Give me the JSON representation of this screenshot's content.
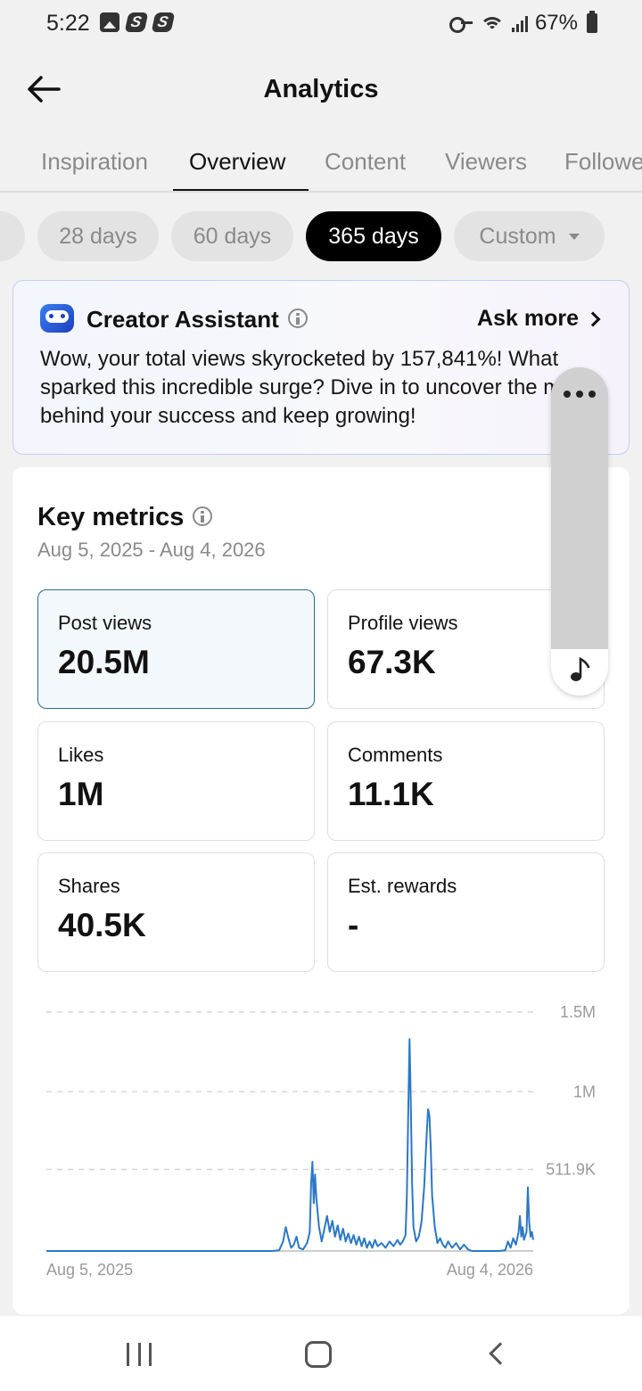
{
  "status_bar": {
    "time": "5:22",
    "battery": "67%"
  },
  "header": {
    "title": "Analytics"
  },
  "tabs": [
    {
      "label": "Inspiration",
      "active": false
    },
    {
      "label": "Overview",
      "active": true
    },
    {
      "label": "Content",
      "active": false
    },
    {
      "label": "Viewers",
      "active": false
    },
    {
      "label": "Followers",
      "active": false
    }
  ],
  "ranges": [
    {
      "label": "28 days",
      "active": false
    },
    {
      "label": "60 days",
      "active": false
    },
    {
      "label": "365 days",
      "active": true
    },
    {
      "label": "Custom",
      "active": false
    }
  ],
  "assistant": {
    "title": "Creator Assistant",
    "ask_more": "Ask more",
    "message": "Wow, your total views skyrocketed by 157,841%! What sparked this incredible surge? Dive in to uncover the magic behind your success and keep growing!"
  },
  "key_metrics": {
    "title": "Key metrics",
    "date_range": "Aug 5, 2025 - Aug 4, 2026",
    "items": [
      {
        "label": "Post views",
        "value": "20.5M",
        "selected": true
      },
      {
        "label": "Profile views",
        "value": "67.3K",
        "selected": false
      },
      {
        "label": "Likes",
        "value": "1M",
        "selected": false
      },
      {
        "label": "Comments",
        "value": "11.1K",
        "selected": false
      },
      {
        "label": "Shares",
        "value": "40.5K",
        "selected": false
      },
      {
        "label": "Est. rewards",
        "value": "-",
        "selected": false
      }
    ]
  },
  "colors": {
    "accent_line": "#2a78c8",
    "selected_border": "#2c6a8e",
    "active_chip": "#000000"
  },
  "chart_data": {
    "type": "line",
    "x_start_label": "Aug 5, 2025",
    "x_end_label": "Aug 4, 2026",
    "y_ticks": [
      {
        "value": 1500000,
        "label": "1.5M"
      },
      {
        "value": 1000000,
        "label": "1M"
      },
      {
        "value": 511900,
        "label": "511.9K"
      }
    ],
    "ylim": [
      0,
      1500000
    ],
    "grid": true,
    "series": [
      {
        "values": [
          [
            0,
            0
          ],
          [
            60,
            0
          ],
          [
            120,
            0
          ],
          [
            170,
            0
          ],
          [
            175,
            5000
          ],
          [
            178,
            60000
          ],
          [
            180,
            150000
          ],
          [
            182,
            80000
          ],
          [
            184,
            20000
          ],
          [
            186,
            40000
          ],
          [
            188,
            90000
          ],
          [
            190,
            20000
          ],
          [
            193,
            10000
          ],
          [
            196,
            50000
          ],
          [
            198,
            120000
          ],
          [
            199,
            420000
          ],
          [
            200,
            560000
          ],
          [
            201,
            300000
          ],
          [
            202,
            480000
          ],
          [
            203,
            330000
          ],
          [
            205,
            150000
          ],
          [
            207,
            60000
          ],
          [
            209,
            140000
          ],
          [
            211,
            220000
          ],
          [
            213,
            120000
          ],
          [
            215,
            190000
          ],
          [
            217,
            90000
          ],
          [
            219,
            160000
          ],
          [
            221,
            70000
          ],
          [
            223,
            140000
          ],
          [
            225,
            60000
          ],
          [
            227,
            110000
          ],
          [
            229,
            50000
          ],
          [
            231,
            100000
          ],
          [
            233,
            40000
          ],
          [
            235,
            90000
          ],
          [
            237,
            30000
          ],
          [
            239,
            80000
          ],
          [
            241,
            20000
          ],
          [
            243,
            60000
          ],
          [
            245,
            20000
          ],
          [
            247,
            70000
          ],
          [
            249,
            30000
          ],
          [
            252,
            50000
          ],
          [
            255,
            20000
          ],
          [
            258,
            60000
          ],
          [
            261,
            30000
          ],
          [
            264,
            70000
          ],
          [
            266,
            40000
          ],
          [
            268,
            60000
          ],
          [
            270,
            100000
          ],
          [
            271,
            350000
          ],
          [
            272,
            850000
          ],
          [
            273,
            1330000
          ],
          [
            274,
            900000
          ],
          [
            275,
            420000
          ],
          [
            276,
            150000
          ],
          [
            278,
            60000
          ],
          [
            280,
            90000
          ],
          [
            282,
            180000
          ],
          [
            284,
            400000
          ],
          [
            286,
            750000
          ],
          [
            287,
            890000
          ],
          [
            288,
            850000
          ],
          [
            289,
            650000
          ],
          [
            290,
            350000
          ],
          [
            292,
            150000
          ],
          [
            294,
            50000
          ],
          [
            296,
            80000
          ],
          [
            298,
            40000
          ],
          [
            300,
            20000
          ],
          [
            302,
            60000
          ],
          [
            305,
            20000
          ],
          [
            308,
            50000
          ],
          [
            311,
            10000
          ],
          [
            314,
            40000
          ],
          [
            317,
            10000
          ],
          [
            320,
            0
          ],
          [
            330,
            0
          ],
          [
            340,
            0
          ],
          [
            345,
            5000
          ],
          [
            347,
            60000
          ],
          [
            349,
            20000
          ],
          [
            351,
            80000
          ],
          [
            353,
            40000
          ],
          [
            355,
            120000
          ],
          [
            356,
            220000
          ],
          [
            357,
            90000
          ],
          [
            358,
            150000
          ],
          [
            359,
            70000
          ],
          [
            361,
            120000
          ],
          [
            362,
            400000
          ],
          [
            363,
            180000
          ],
          [
            364,
            90000
          ],
          [
            365,
            120000
          ],
          [
            366,
            70000
          ]
        ]
      }
    ]
  }
}
